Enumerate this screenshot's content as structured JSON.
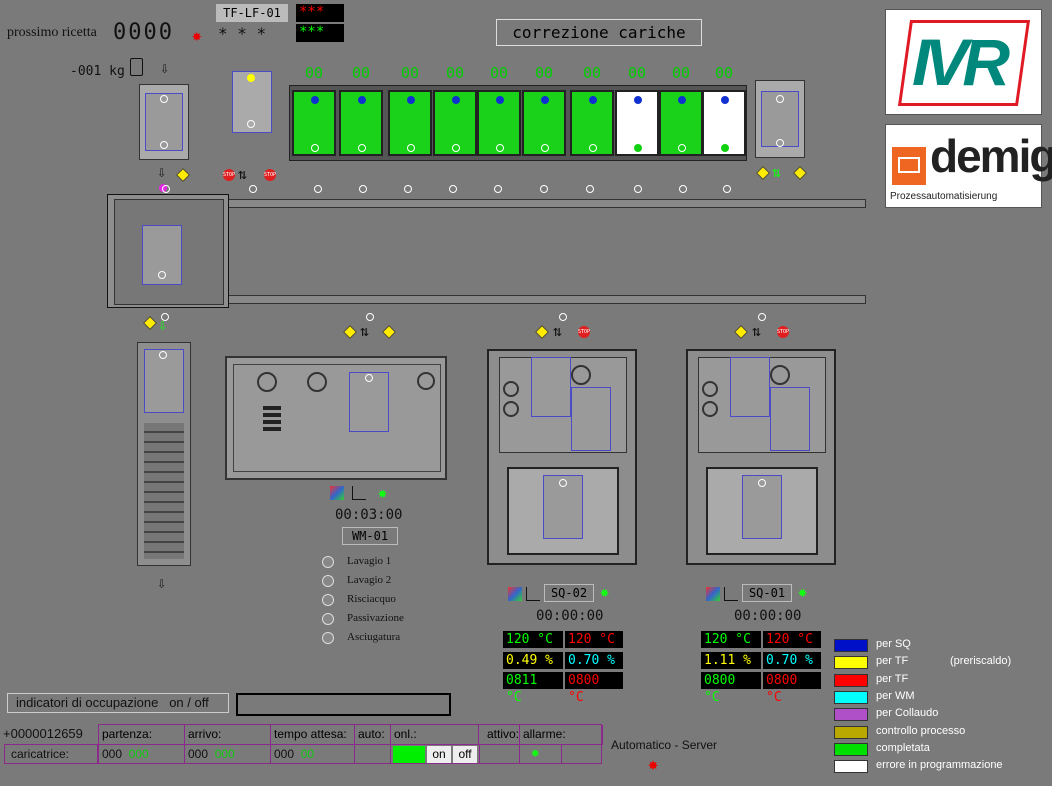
{
  "header": {
    "next_recipe_label": "prossimo ricetta",
    "next_recipe_value": "0000",
    "line_id": "TF-LF-01",
    "red_stars": "***",
    "green_stars": "***",
    "grey_stars": "* * *",
    "weight": "-001 kg",
    "correction_button": "correzione cariche"
  },
  "slots": {
    "counters": [
      "00",
      "00",
      "00",
      "00",
      "00",
      "00",
      "00",
      "00",
      "00",
      "00"
    ],
    "fills": [
      "#19d219",
      "#19d219",
      "#19d219",
      "#19d219",
      "#19d219",
      "#19d219",
      "#19d219",
      "#ffffff",
      "#19d219",
      "#ffffff"
    ]
  },
  "logos": {
    "ivr": "IVR",
    "demig_title": "demig",
    "demig_subtitle": "Prozessautomatisierung"
  },
  "wm": {
    "timer": "00:03:00",
    "id": "WM-01",
    "steps": [
      "Lavagio 1",
      "Lavagio 2",
      "Risciacquo",
      "Passivazione",
      "Asciugatura"
    ]
  },
  "sq2": {
    "id": "SQ-02",
    "timer": "00:00:00",
    "temp1": "120 °C",
    "temp2": "120 °C",
    "pct1": "0.49 %",
    "pct2": "0.70 %",
    "val1": "0811 °C",
    "val2": "0800 °C"
  },
  "sq1": {
    "id": "SQ-01",
    "timer": "00:00:00",
    "temp1": "120 °C",
    "temp2": "120 °C",
    "pct1": "1.11 %",
    "pct2": "0.70 %",
    "val1": "0800 °C",
    "val2": "0800 °C"
  },
  "legend": {
    "items": [
      {
        "label": "per SQ",
        "color": "#0010c8"
      },
      {
        "label": "per TF",
        "color": "#ffff00"
      },
      {
        "label": "per TF",
        "color": "#ff0000"
      },
      {
        "label": "per WM",
        "color": "#00ffff"
      },
      {
        "label": "per Collaudo",
        "color": "#b050c8"
      },
      {
        "label": "controllo processo",
        "color": "#b8a800"
      },
      {
        "label": "completata",
        "color": "#00e000"
      },
      {
        "label": "errore in programmazione",
        "color": "#ffffff"
      }
    ],
    "note": "(preriscaldo)"
  },
  "occupancy": {
    "label": "indicatori di occupazione   on / off"
  },
  "status": {
    "counter": "+0000012659",
    "headers": {
      "partenza": "partenza:",
      "arrivo": "arrivo:",
      "tempo": "tempo attesa:",
      "auto": "auto:",
      "onl": "onl.:",
      "attivo": "attivo:",
      "allarme": "allarme:"
    },
    "row_label": "caricatrice:",
    "partenza_val1": "000",
    "partenza_val2": "000",
    "arrivo_val1": "000",
    "arrivo_val2": "000",
    "tempo_val1": "000",
    "tempo_val2": "00",
    "on_label": "on",
    "off_label": "off"
  },
  "server_status": "Automatico - Server"
}
